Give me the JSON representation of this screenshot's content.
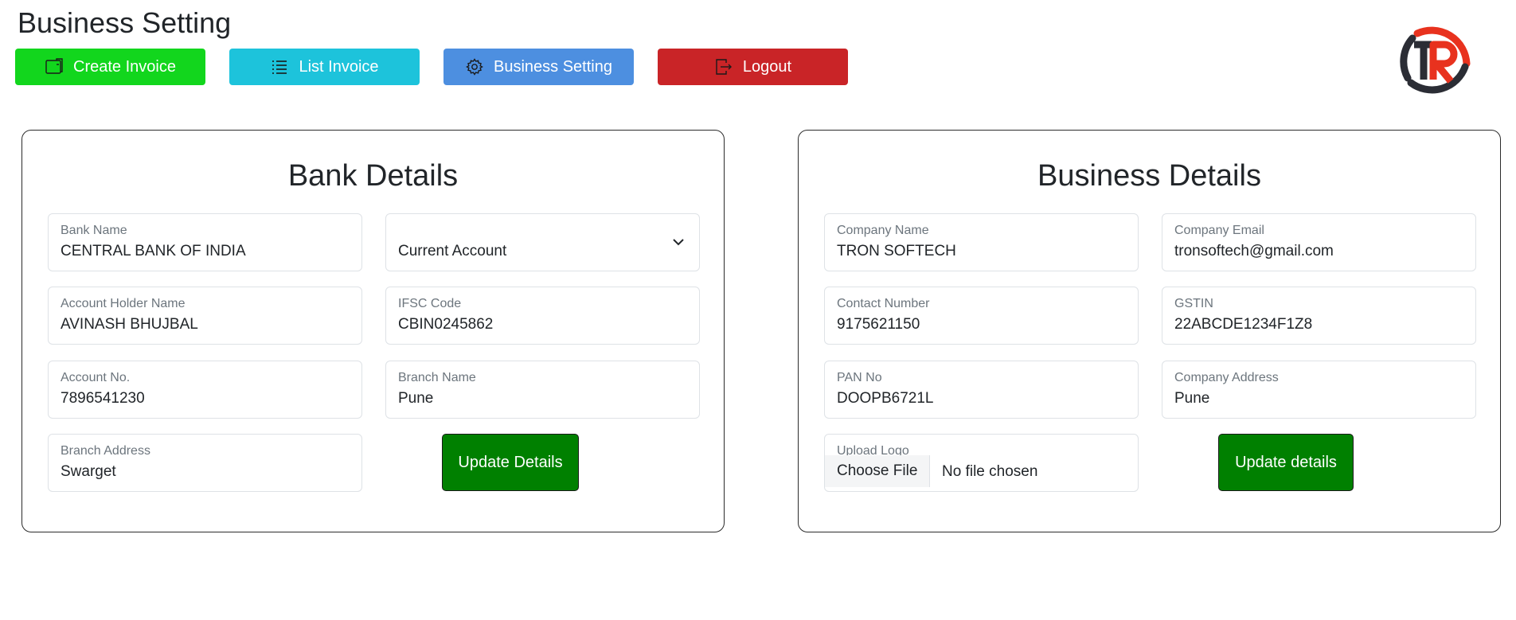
{
  "page": {
    "title": "Business Setting"
  },
  "nav": {
    "create_invoice": "Create Invoice",
    "list_invoice": "List Invoice",
    "business_setting": "Business Setting",
    "logout": "Logout"
  },
  "colors": {
    "create_invoice": "#12d61d",
    "list_invoice": "#1dc3db",
    "business_setting": "#4d8fe0",
    "logout": "#c92427",
    "update_button": "#008000",
    "logo_red": "#e8321e",
    "logo_dark": "#2b2d35"
  },
  "bank": {
    "title": "Bank Details",
    "bank_name": {
      "label": "Bank Name",
      "value": "CENTRAL BANK OF INDIA"
    },
    "account_type": {
      "value": "Current Account"
    },
    "holder_name": {
      "label": "Account Holder Name",
      "value": "AVINASH BHUJBAL"
    },
    "ifsc": {
      "label": "IFSC Code",
      "value": "CBIN0245862"
    },
    "account_no": {
      "label": "Account No.",
      "value": "7896541230"
    },
    "branch_name": {
      "label": "Branch Name",
      "value": "Pune"
    },
    "branch_address": {
      "label": "Branch Address",
      "value": "Swarget"
    },
    "update_label": "Update Details"
  },
  "business": {
    "title": "Business Details",
    "company_name": {
      "label": "Company Name",
      "value": "TRON SOFTECH"
    },
    "company_email": {
      "label": "Company Email",
      "value": "tronsoftech@gmail.com"
    },
    "contact_number": {
      "label": "Contact Number",
      "value": "9175621150"
    },
    "gstin": {
      "label": "GSTIN",
      "value": "22ABCDE1234F1Z8"
    },
    "pan_no": {
      "label": "PAN No",
      "value": "DOOPB6721L"
    },
    "company_address": {
      "label": "Company Address",
      "value": "Pune"
    },
    "upload_logo": {
      "label": "Upload Logo",
      "button": "Choose File",
      "status": "No file chosen"
    },
    "update_label": "Update details"
  },
  "icons": {
    "create_invoice": "invoice-icon",
    "list_invoice": "list-icon",
    "business_setting": "gear-icon",
    "logout": "logout-icon",
    "select": "chevron-down-icon"
  }
}
